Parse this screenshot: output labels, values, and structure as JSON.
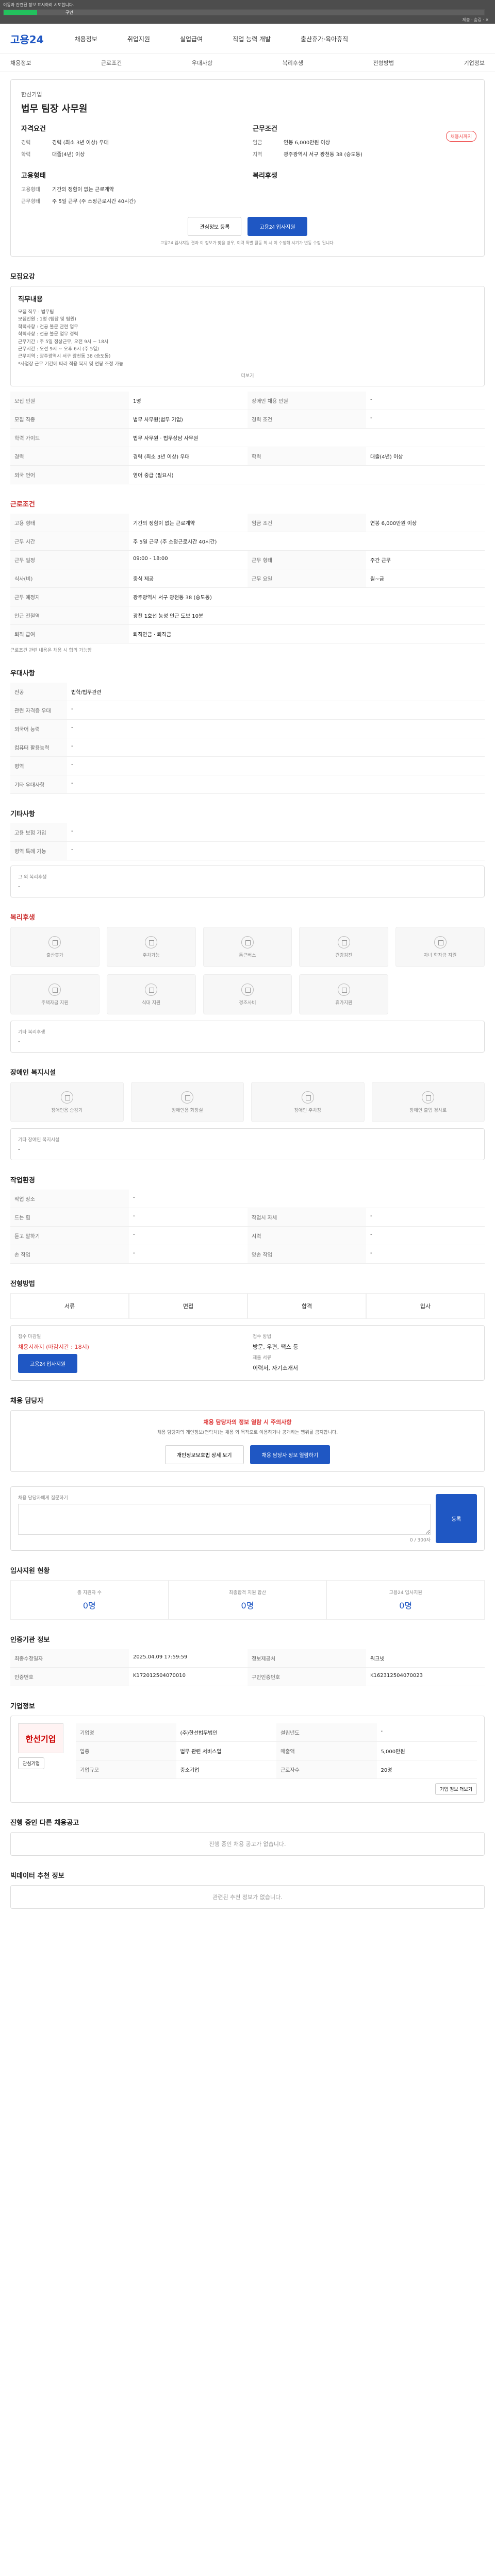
{
  "top": {
    "note": "이동과 관련된 정보 표시하려 시도합니다.",
    "progress_label": "구인",
    "progress_percent": 7,
    "right_label": "제출 · 숨김 · ✕"
  },
  "site": {
    "logo": "고용24",
    "gnb": [
      "채용정보",
      "취업지원",
      "실업급여",
      "직업 능력 개발",
      "출산휴가·육아휴직"
    ],
    "subnav": [
      "채용정보",
      "근로조건",
      "우대사항",
      "복리후생",
      "전형방법",
      "기업정보"
    ]
  },
  "job": {
    "company_label": "한선기업",
    "title": "법무 팀장 사무원",
    "badge": "채용시까지",
    "left_title": "자격요건",
    "right_title": "근무조건",
    "left_kv": [
      {
        "k": "경력",
        "v": "경력 (최소 3년 이상) 우대"
      },
      {
        "k": "학력",
        "v": "대졸(4년) 이상"
      }
    ],
    "right_kv": [
      {
        "k": "임금",
        "v": "연봉 6,000만원 이상"
      },
      {
        "k": "지역",
        "v": "광주광역시 서구 광천동 38 (승도동)"
      }
    ],
    "left2_title": "고용형태",
    "right2_title": "복리후생",
    "left2_kv": [
      {
        "k": "고용형태",
        "v": "기간의 정함이 없는 근로계약"
      },
      {
        "k": "근무형태",
        "v": "주 5일 근무 (주 소정근로시간 40시간)"
      }
    ],
    "buttons": {
      "save": "관심정보 등록",
      "apply": "고용24 입사지원"
    },
    "small_note": "고용24 입사지원 결과 이 정보가 맞을 경우, 이력 특별 활동 최 시 이 수정해 시기가 변동 수정 됩니다."
  },
  "recruit": {
    "title": "모집요강",
    "duties_title": "직무내용",
    "duties": [
      "모집 직무 : 법무팀",
      "모집인원 : 1명 (팀장 및 팀원)",
      "학력사항 : 전공 불문 관련 업무",
      "학력사항 : 전공 불문 업무 경력",
      "근무기간 : 주 5일 정상근무, 오전 9시 ~ 18시",
      "근무시간 : 오전 9시 ~ 오후 6시 (주 5일)",
      "근무지역 : 광주광역시 서구 광천동 38 (승도동)",
      "*사업장 근무 기간에 따라 적용 복지 및 연봉 조정 가능"
    ],
    "more": "더보기",
    "rows": [
      {
        "k": "모집 인원",
        "v": "1명",
        "k2": "장애인 채용 인원",
        "v2": "-"
      },
      {
        "k": "모집 직종",
        "v": "법무 사무원(법무 기업)",
        "k2": "경력 조건",
        "v2": "-"
      },
      {
        "k": "학력 가이드",
        "v": "법무 사무원 · 법무상담 사무원",
        "k2": "",
        "v2": ""
      },
      {
        "k": "경력",
        "v": "경력 (최소 3년 이상) 우대",
        "k2": "학력",
        "v2": "대졸(4년) 이상"
      },
      {
        "k": "외국 언어",
        "v": "영어 중급 (필요시)",
        "k2": "",
        "v2": ""
      }
    ]
  },
  "conditions": {
    "title": "근로조건",
    "rows": [
      {
        "k": "고용 형태",
        "v": "기간의 정함이 없는 근로계약",
        "k2": "임금 조건",
        "v2": "연봉 6,000만원 이상"
      },
      {
        "k": "근무 시간",
        "v": "주 5일 근무 (주 소정근로시간 40시간)",
        "k2": "",
        "v2": ""
      },
      {
        "k": "근무 일정",
        "v": "09:00 - 18:00",
        "k2": "근무 형태",
        "v2": "주간 근무"
      },
      {
        "k": "식사(비)",
        "v": "중식 제공",
        "k2": "근무 요일",
        "v2": "월~금"
      },
      {
        "k": "근무 예정지",
        "v": "광주광역시 서구 광천동 38 (승도동)",
        "k2": "",
        "v2": ""
      },
      {
        "k": "인근 전철역",
        "v": "광천 1호선 농성 인근 도보 10분",
        "k2": "",
        "v2": ""
      },
      {
        "k": "퇴직 급여",
        "v": "퇴직연금 · 퇴직금",
        "k2": "",
        "v2": ""
      }
    ],
    "note": "근로조건 관련 내용은 채용 시 협의 가능함"
  },
  "prefer": {
    "title": "우대사항",
    "rows": [
      {
        "k": "전공",
        "v": "법학/법무관련"
      },
      {
        "k": "관련 자격증 우대",
        "v": "-"
      },
      {
        "k": "외국어 능력",
        "v": "-"
      },
      {
        "k": "컴퓨터 활용능력",
        "v": "-"
      },
      {
        "k": "병역",
        "v": "-"
      },
      {
        "k": "기타 우대사항",
        "v": "-"
      }
    ]
  },
  "etc": {
    "title": "기타사항",
    "rows": [
      {
        "k": "고용 보험 가입",
        "v": "-"
      },
      {
        "k": "병역 특례 가능",
        "v": "-"
      }
    ],
    "sub": "그 외 복리후생",
    "sub_value": "-"
  },
  "benefits": {
    "title": "복리후생",
    "items": [
      "출산휴가",
      "주차가능",
      "통근버스",
      "건강검진",
      "자녀 학자금 지원",
      "주택자금 지원",
      "식대 지원",
      "경조사비",
      "휴가지원"
    ],
    "sub_title": "기타 복리후생",
    "sub_value": "-"
  },
  "disability": {
    "title": "장애인 복지시설",
    "items": [
      "장애인용 승강기",
      "장애인용 화장실",
      "장애인 주차장",
      "장애인 출입 경사로"
    ],
    "sub_title": "기타 장애인 복지시설",
    "sub_value": "-"
  },
  "env": {
    "title": "작업환경",
    "rows": [
      {
        "k": "작업 장소",
        "v": "-",
        "k2": "",
        "v2": ""
      },
      {
        "k": "드는 힘",
        "v": "-",
        "k2": "작업시 자세",
        "v2": "-"
      },
      {
        "k": "듣고 말하기",
        "v": "-",
        "k2": "시력",
        "v2": "-"
      },
      {
        "k": "손 작업",
        "v": "-",
        "k2": "양손 작업",
        "v2": "-"
      }
    ]
  },
  "process": {
    "title": "전형방법",
    "steps": [
      "서류",
      "면접",
      "합격",
      "입사"
    ],
    "apply_label": "접수 마감일",
    "apply_value": "채용시까지 (마감시간 : 18시)",
    "apply_btn": "고용24 입사지원",
    "method_label": "접수 방법",
    "method_value": "방문, 우편, 팩스 등",
    "docs_label": "제출 서류",
    "docs_value": "이력서, 자기소개서"
  },
  "manager": {
    "title": "채용 담당자",
    "alert": "채용 담당자의 정보 열람 시 주의사항",
    "desc": "채용 담당자의 개인정보(연락처)는 채용 외 목적으로 이용하거나 공개하는 행위를 금지합니다.",
    "btn1": "개인정보보호법 상세 보기",
    "btn2": "채용 담당자 정보 열람하기"
  },
  "contact": {
    "title": "채용 담당자에게 질문하기",
    "counter": "0 / 300자",
    "submit": "등록"
  },
  "stats": {
    "title": "입사지원 현황",
    "items": [
      {
        "k": "총 지원자 수",
        "v": "0명"
      },
      {
        "k": "최종합격 지원 합산",
        "v": "0명"
      },
      {
        "k": "고용24 입사지원",
        "v": "0명"
      }
    ]
  },
  "agency": {
    "title": "인증기관 정보",
    "rows": [
      {
        "k": "최종수정일자",
        "v": "2025.04.09 17:59:59",
        "k2": "정보제공처",
        "v2": "워크넷"
      },
      {
        "k": "인증번호",
        "v": "K172012504070010",
        "k2": "구인인증번호",
        "v2": "K162312504070023"
      }
    ]
  },
  "company": {
    "title": "기업정보",
    "logo_text": "한선기업",
    "name": "한선기업",
    "rows": [
      {
        "k": "기업명",
        "v": "(주)한선법무법인",
        "k2": "설립년도",
        "v2": "-"
      },
      {
        "k": "업종",
        "v": "법무 관련 서비스업",
        "k2": "매출액",
        "v2": "5,000만원"
      },
      {
        "k": "기업규모",
        "v": "중소기업",
        "k2": "근로자수",
        "v2": "20명"
      }
    ],
    "btn1": "관심기업",
    "btn2": "기업 정보 더보기"
  },
  "other_jobs": {
    "title": "진행 중인 다른 채용공고",
    "empty": "진행 중인 채용 공고가 없습니다."
  },
  "recommend": {
    "title": "빅데이터 추천 정보",
    "empty": "관련된 추천 정보가 없습니다."
  }
}
